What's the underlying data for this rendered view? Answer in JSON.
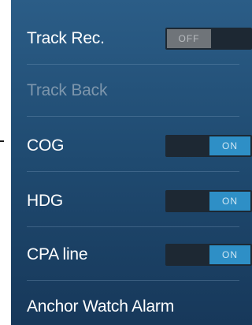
{
  "settings": {
    "rows": [
      {
        "label": "Track Rec.",
        "toggle": "OFF"
      },
      {
        "label": "Track Back"
      },
      {
        "label": "COG",
        "toggle": "ON"
      },
      {
        "label": "HDG",
        "toggle": "ON"
      },
      {
        "label": "CPA line",
        "toggle": "ON"
      },
      {
        "label": "Anchor Watch Alarm"
      }
    ]
  },
  "colors": {
    "panel_top": "#2b5d87",
    "panel_bottom": "#17385a",
    "toggle_on": "#2e8fc6",
    "toggle_off": "#6f7479",
    "disabled_text": "#7d96ac"
  }
}
